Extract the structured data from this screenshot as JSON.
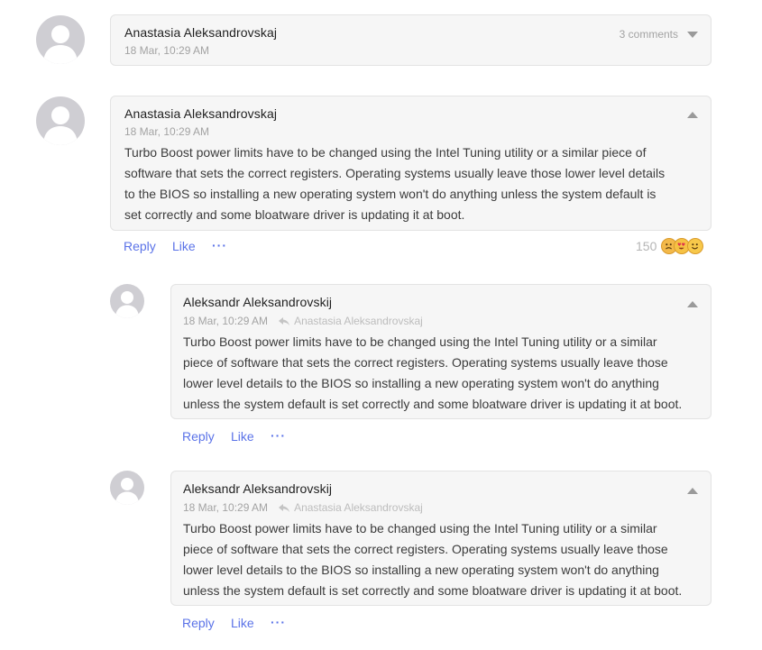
{
  "comments": [
    {
      "author": "Anastasia Aleksandrovskaj",
      "time": "18 Mar, 10:29 AM",
      "collapsed_label": "3 comments"
    },
    {
      "author": "Anastasia Aleksandrovskaj",
      "time": "18 Mar, 10:29 AM",
      "lines": [
        "Turbo Boost power limits have to be changed using the Intel Tuning utility or a similar piece of",
        "software that sets the correct registers. Operating systems usually leave those lower level details",
        "to the BIOS so installing a new operating system won't do anything unless the system default is",
        "set correctly and some bloatware driver is updating it at boot."
      ],
      "actions": {
        "reply": "Reply",
        "like": "Like",
        "more": "···"
      },
      "reactions": {
        "count": "150"
      }
    },
    {
      "author": "Aleksandr Aleksandrovskij",
      "time": "18 Mar, 10:29 AM",
      "reply_to": "Anastasia Aleksandrovskaj",
      "lines": [
        "Turbo Boost power limits have to be changed using the Intel Tuning utility or a similar",
        "piece of software that sets the correct registers. Operating systems usually leave those",
        "lower level details to the BIOS so installing a new operating system won't do anything",
        "unless the system default is set correctly and some bloatware driver is updating it at boot."
      ],
      "actions": {
        "reply": "Reply",
        "like": "Like",
        "more": "···"
      }
    },
    {
      "author": "Aleksandr Aleksandrovskij",
      "time": "18 Mar, 10:29 AM",
      "reply_to": "Anastasia Aleksandrovskaj",
      "lines": [
        "Turbo Boost power limits have to be changed using the Intel Tuning utility or a similar",
        "piece of software that sets the correct registers. Operating systems usually leave those",
        "lower level details to the BIOS so installing a new operating system won't do anything",
        "unless the system default is set correctly and some bloatware driver is updating it at boot."
      ],
      "actions": {
        "reply": "Reply",
        "like": "Like",
        "more": "···"
      }
    }
  ],
  "colors": {
    "accent": "#5b73e8",
    "card_bg": "#f6f6f6",
    "card_border": "#e3e3e3",
    "avatar_bg": "#cfced3"
  },
  "icons": {
    "avatar": "user-silhouette-icon",
    "reply_to": "reply-arrow-icon",
    "expand": "chevron-down-icon",
    "collapse": "chevron-up-icon",
    "reactions": [
      "sad-face-icon",
      "heart-eyes-icon",
      "smile-face-icon"
    ]
  }
}
